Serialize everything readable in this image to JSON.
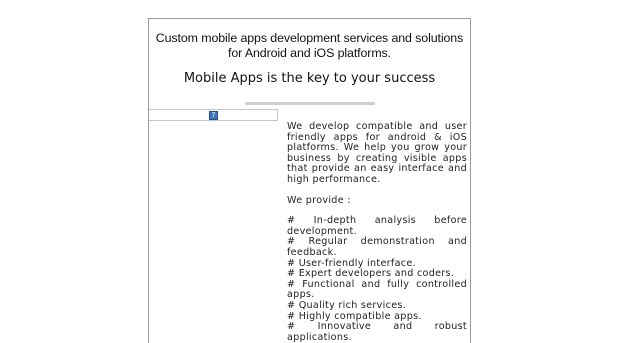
{
  "headline": "Custom mobile apps development services and solutions for Android and iOS platforms.",
  "subheadline": "Mobile Apps is the key to your success",
  "broken_image_icon": "broken-image-icon",
  "intro": "We develop compatible and user friendly apps for android & iOS platforms. We help you grow your business by creating visible apps that provide an easy interface and high performance.",
  "provide_label": "We provide :",
  "items": [
    "# In-depth analysis before development.",
    "# Regular demonstration and feedback.",
    "# User-friendly interface.",
    "# Expert developers and coders.",
    "# Functional and fully controlled apps.",
    "# Quality rich services.",
    "# Highly compatible apps.",
    "# Innovative and robust applications."
  ],
  "colors": {
    "border": "#9a9a9a",
    "divider": "#d0d0d0",
    "icon": "#3a78c4",
    "text": "#222222"
  }
}
